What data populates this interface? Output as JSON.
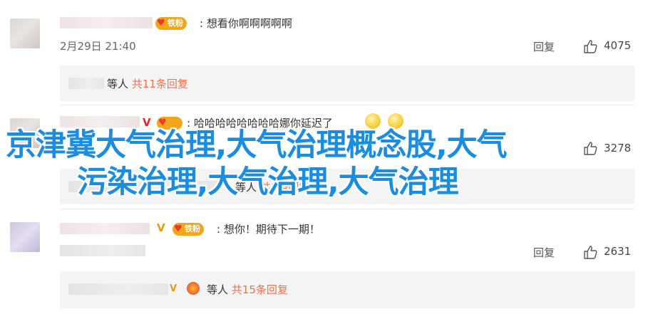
{
  "comments": [
    {
      "text": ": 想看你啊啊啊啊啊",
      "timestamp": "2月29日 21:40",
      "reply_label": "回复",
      "like_count": "4075",
      "fan_badge": "铁粉",
      "thread": {
        "prefix": "等人",
        "link": "共11条回复"
      }
    },
    {
      "text": ": 哈哈哈哈哈哈哈哈娜你延迟了",
      "like_count": "3278",
      "thread": {
        "prefix": "等人",
        "link": "共3条回复"
      }
    },
    {
      "text": ": 想你！期待下一期！",
      "reply_label": "回复",
      "like_count": "2631",
      "fan_badge": "铁粉",
      "thread": {
        "prefix": "等人",
        "link": "共15条回复"
      }
    }
  ],
  "overlay": {
    "line1": "京津冀大气治理,大气治理概念股,大气",
    "line2": "污染治理,大气治理,大气治理"
  },
  "colors": {
    "accent_link": "#eb7350",
    "overlay_blue": "#1b8de0",
    "badge_orange": "#f2a61a"
  },
  "icons": [
    "thumbs-up-icon",
    "verified-v-icon",
    "fan-flame-icon",
    "emoji-icon"
  ]
}
